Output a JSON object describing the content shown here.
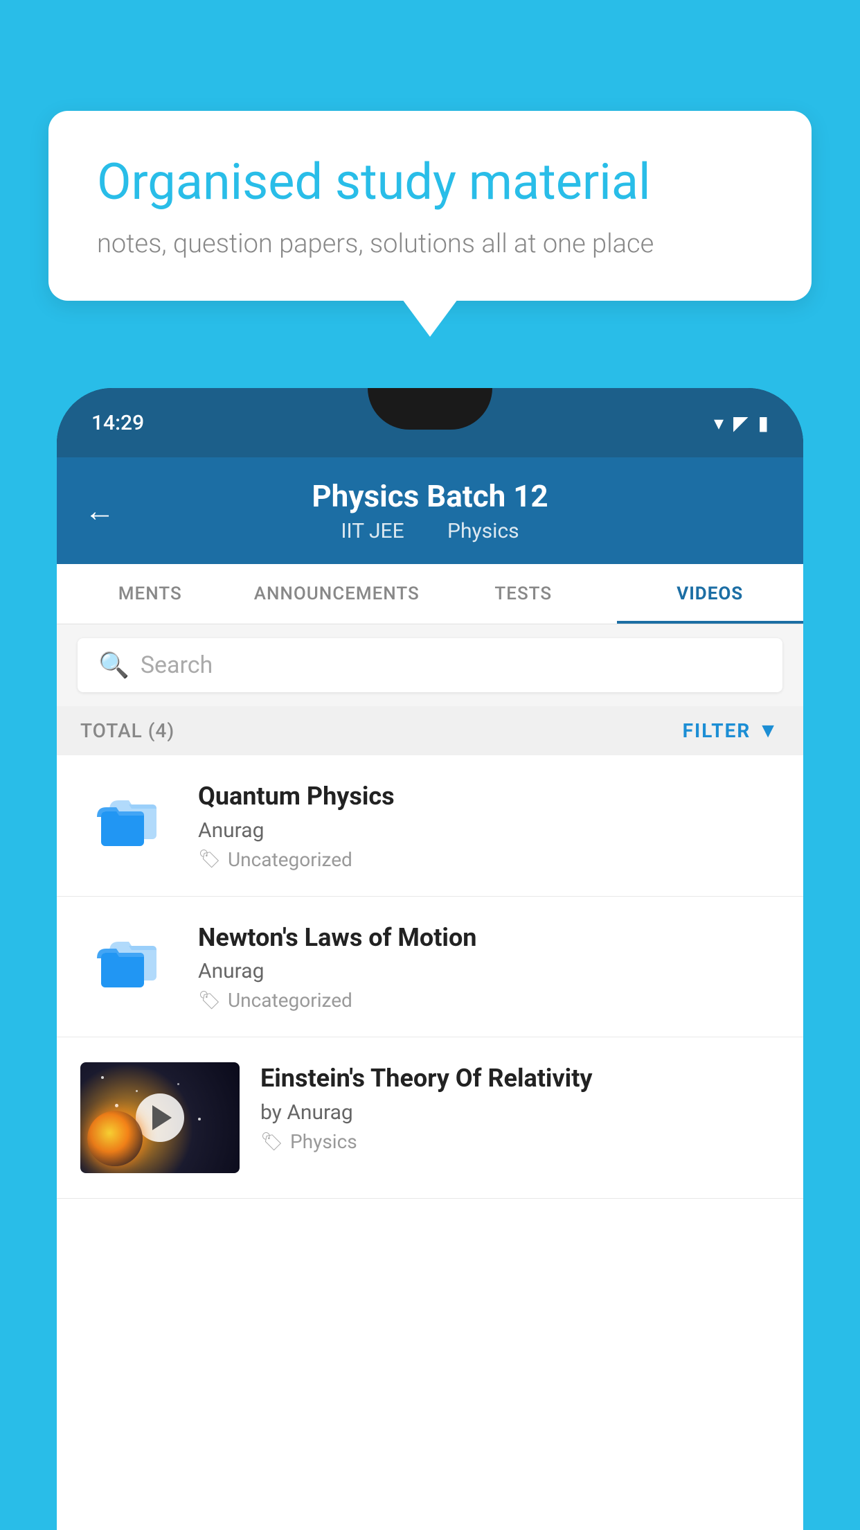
{
  "background_color": "#29bde8",
  "bubble": {
    "title": "Organised study material",
    "subtitle": "notes, question papers, solutions all at one place"
  },
  "phone": {
    "status_bar": {
      "time": "14:29",
      "signal": "▼▲▌"
    },
    "header": {
      "title": "Physics Batch 12",
      "subtitle_left": "IIT JEE",
      "subtitle_right": "Physics",
      "back_label": "←"
    },
    "tabs": [
      {
        "label": "MENTS",
        "active": false
      },
      {
        "label": "ANNOUNCEMENTS",
        "active": false
      },
      {
        "label": "TESTS",
        "active": false
      },
      {
        "label": "VIDEOS",
        "active": true
      }
    ],
    "search": {
      "placeholder": "Search"
    },
    "filter_bar": {
      "total": "TOTAL (4)",
      "filter_label": "FILTER"
    },
    "videos": [
      {
        "id": 1,
        "title": "Quantum Physics",
        "author": "Anurag",
        "tag": "Uncategorized",
        "type": "folder"
      },
      {
        "id": 2,
        "title": "Newton's Laws of Motion",
        "author": "Anurag",
        "tag": "Uncategorized",
        "type": "folder"
      },
      {
        "id": 3,
        "title": "Einstein's Theory Of Relativity",
        "author": "by Anurag",
        "tag": "Physics",
        "type": "video"
      }
    ]
  }
}
